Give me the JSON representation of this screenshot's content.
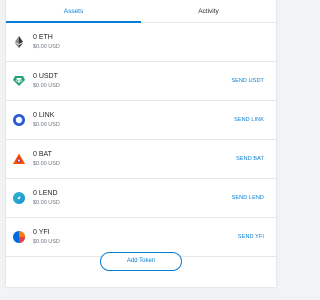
{
  "tabs": [
    {
      "label": "Assets",
      "active": true
    },
    {
      "label": "Activity",
      "active": false
    }
  ],
  "tokens": [
    {
      "amount": "0 ETH",
      "fiat": "$0.00 USD",
      "send": "",
      "icon": "eth-icon",
      "color": "#3c3c3d"
    },
    {
      "amount": "0 USDT",
      "fiat": "$0.00 USD",
      "send": "SEND USDT",
      "icon": "usdt-icon",
      "color": "#26a17b"
    },
    {
      "amount": "0 LINK",
      "fiat": "$0.00 USD",
      "send": "SEND LINK",
      "icon": "link-icon",
      "color": "#2a5ada"
    },
    {
      "amount": "0 BAT",
      "fiat": "$0.00 USD",
      "send": "SEND BAT",
      "icon": "bat-icon",
      "color": "#ff5000"
    },
    {
      "amount": "0 LEND",
      "fiat": "$0.00 USD",
      "send": "SEND LEND",
      "icon": "lend-icon",
      "color": "#2ebac6"
    },
    {
      "amount": "0 YFI",
      "fiat": "$0.00 USD",
      "send": "SEND YFI",
      "icon": "yfi-icon",
      "color": "#006ae3"
    }
  ],
  "add_token_label": "Add Token",
  "accent_color": "#037dd6"
}
